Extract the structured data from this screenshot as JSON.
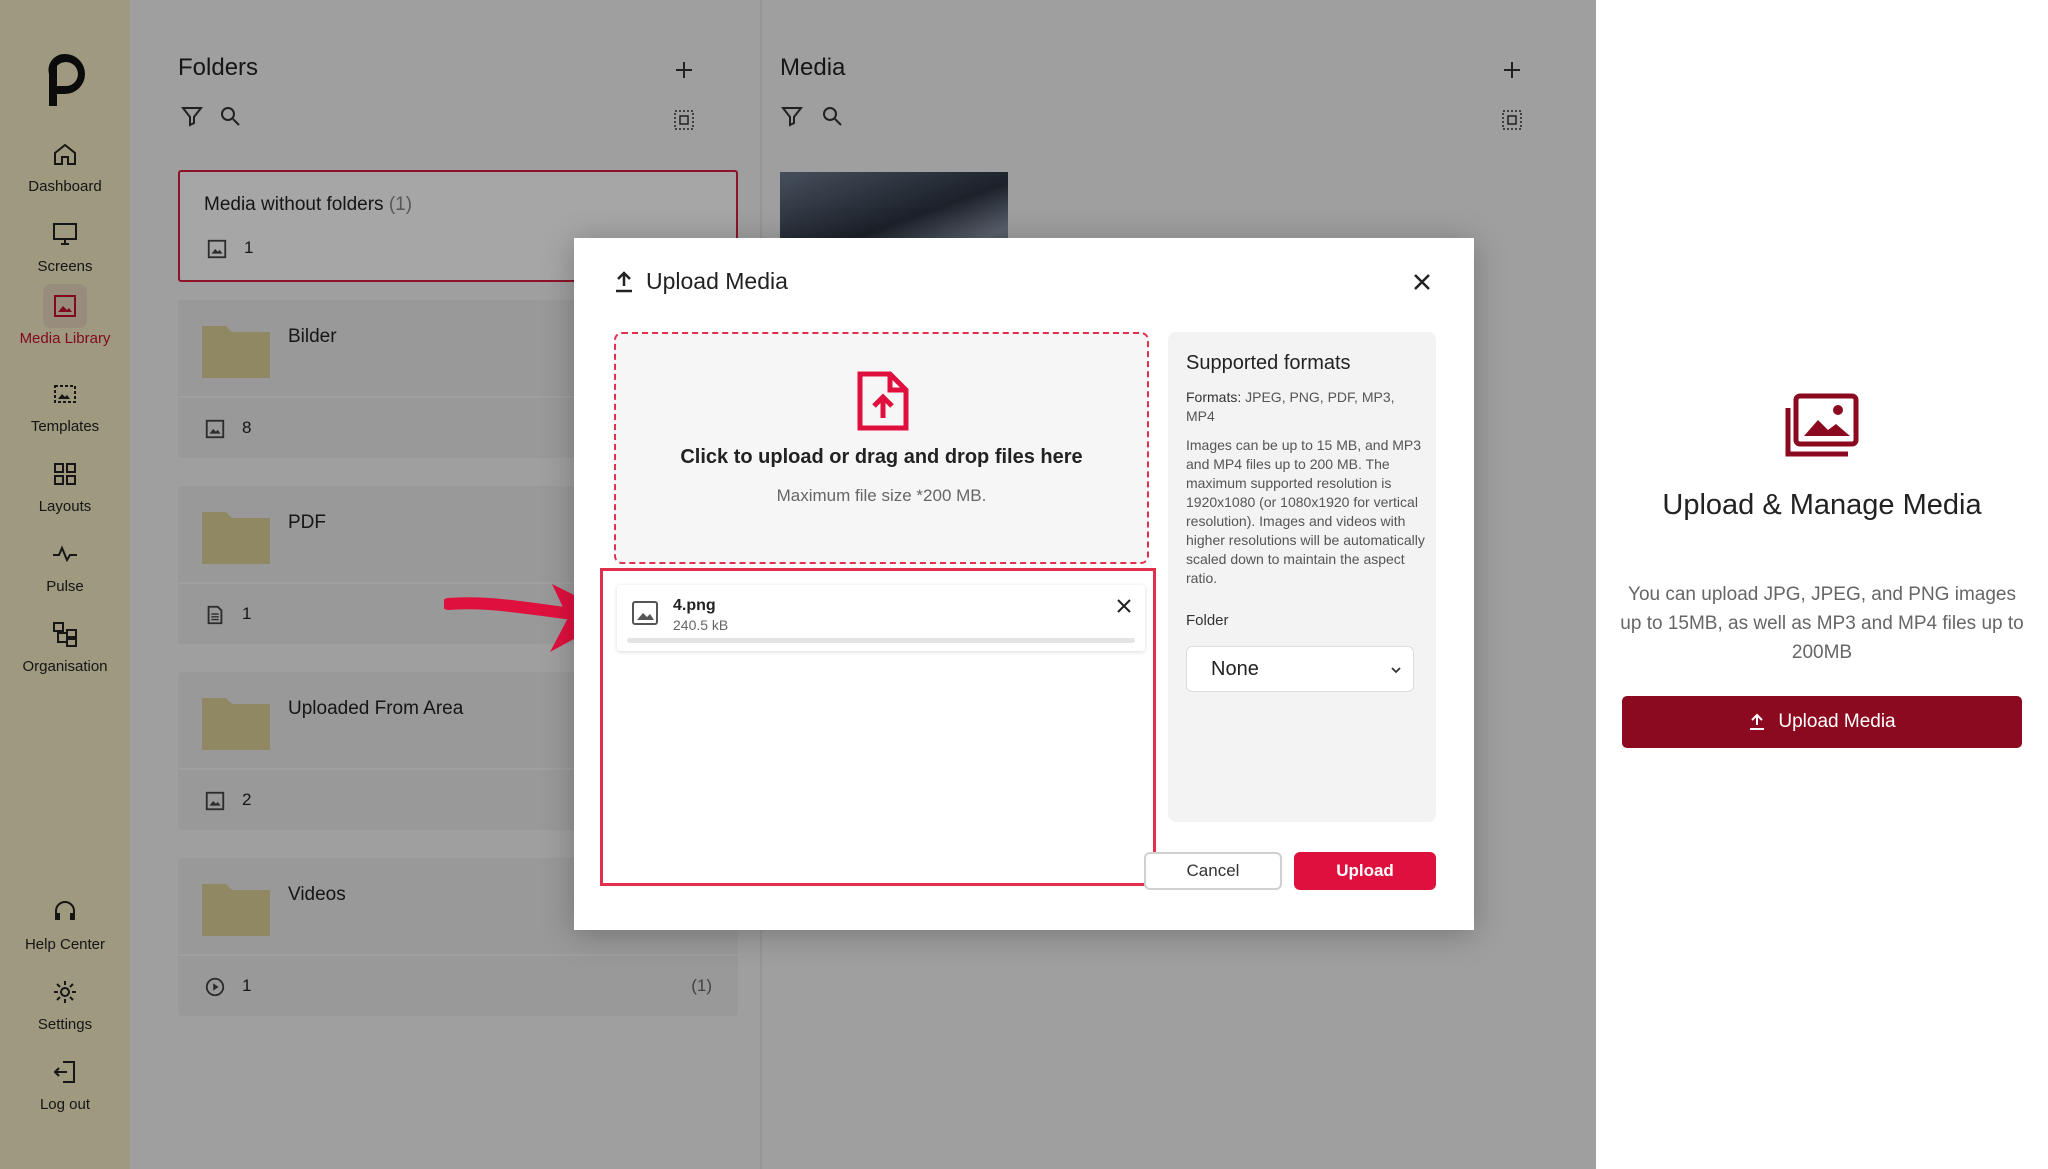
{
  "sidebar": {
    "items": [
      {
        "label": "Dashboard",
        "icon": "home-icon"
      },
      {
        "label": "Screens",
        "icon": "monitor-icon"
      },
      {
        "label": "Media Library",
        "icon": "image-icon",
        "active": true
      },
      {
        "label": "Templates",
        "icon": "template-icon"
      },
      {
        "label": "Layouts",
        "icon": "grid-icon"
      },
      {
        "label": "Pulse",
        "icon": "pulse-icon"
      },
      {
        "label": "Organisation",
        "icon": "org-icon"
      }
    ],
    "bottom": [
      {
        "label": "Help Center",
        "icon": "headset-icon"
      },
      {
        "label": "Settings",
        "icon": "gear-icon"
      },
      {
        "label": "Log out",
        "icon": "logout-icon"
      }
    ]
  },
  "folders": {
    "title": "Folders",
    "no_folder": {
      "title": "Media without folders",
      "count_label": "(1)",
      "count": "1"
    },
    "items": [
      {
        "name": "Bilder",
        "count": "8",
        "icon": "image-icon"
      },
      {
        "name": "PDF",
        "count": "1",
        "icon": "document-icon"
      },
      {
        "name": "Uploaded From Area",
        "count": "2",
        "icon": "image-icon"
      },
      {
        "name": "Videos",
        "count": "1",
        "icon": "play-icon",
        "extra": "(1)"
      }
    ]
  },
  "media": {
    "title": "Media"
  },
  "right_panel": {
    "title": "Upload & Manage Media",
    "description": "You can upload JPG, JPEG, and PNG images up to 15MB, as well as MP3 and MP4 files up to 200MB",
    "button": "Upload Media"
  },
  "modal": {
    "title": "Upload Media",
    "dropzone": {
      "main": "Click to upload or drag and drop files here",
      "sub": "Maximum file size *200 MB."
    },
    "file": {
      "name": "4.png",
      "size": "240.5 kB"
    },
    "formats": {
      "title": "Supported formats",
      "label": "Formats:",
      "list": "JPEG, PNG, PDF, MP3, MP4",
      "description": "Images can be up to 15 MB, and MP3 and MP4 files up to 200 MB. The maximum supported resolution is 1920x1080 (or 1080x1920 for vertical resolution). Images and videos with higher resolutions will be automatically scaled down to maintain the aspect ratio.",
      "folder_label": "Folder",
      "folder_value": "None"
    },
    "cancel": "Cancel",
    "upload": "Upload"
  },
  "colors": {
    "accent": "#e0103e",
    "sidebar": "#f3ebc3",
    "brand_dark": "#8b0a1f"
  }
}
